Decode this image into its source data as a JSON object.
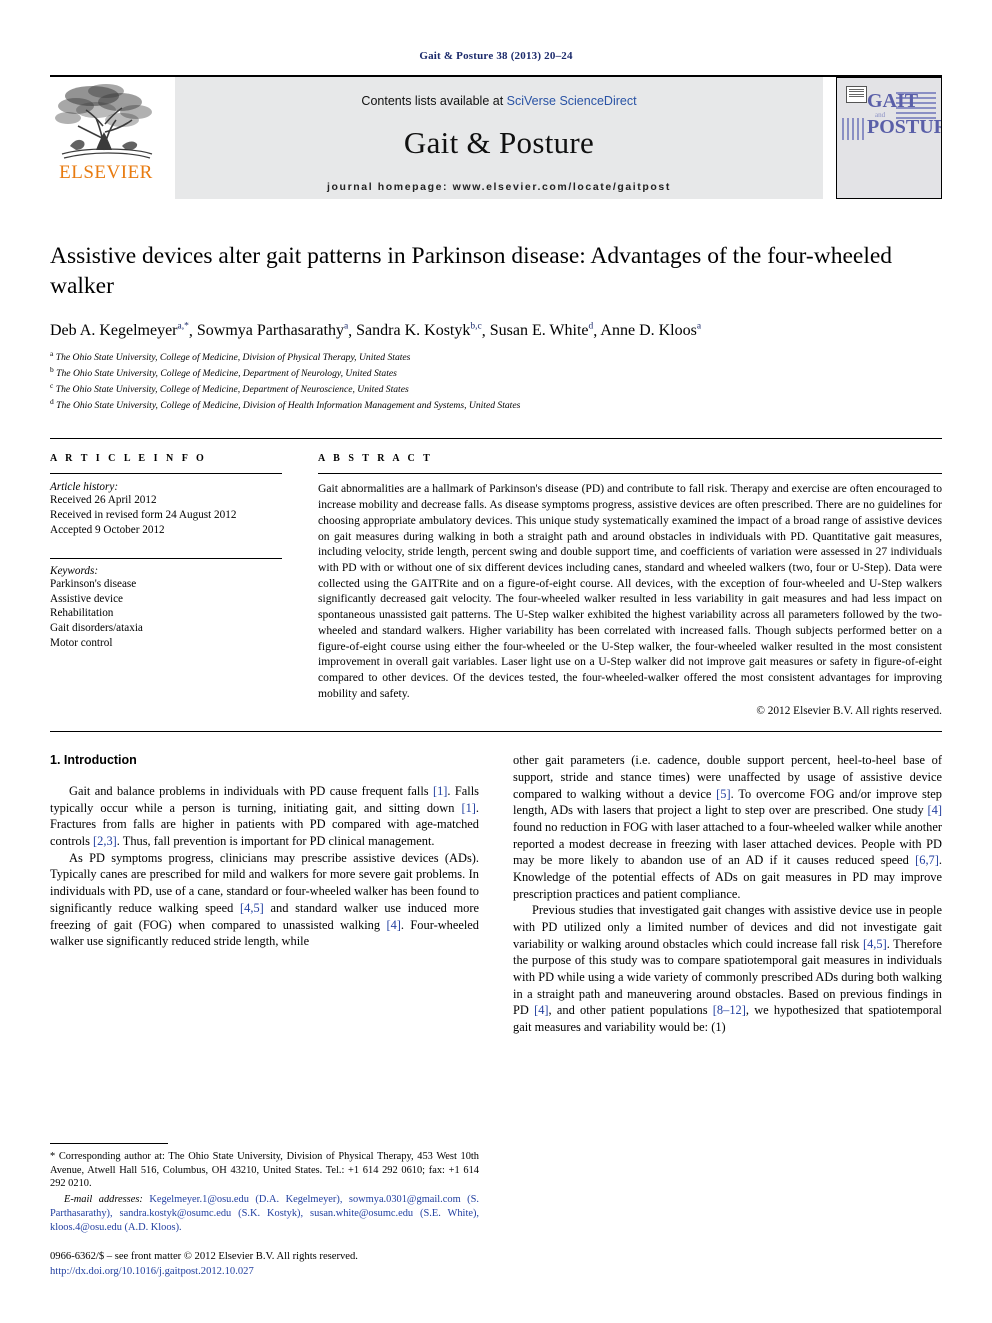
{
  "running_head": "Gait & Posture 38 (2013) 20–24",
  "masthead": {
    "publisher_wordmark": "ELSEVIER",
    "contents_prefix": "Contents lists available at ",
    "contents_link": "SciVerse ScienceDirect",
    "journal_name": "Gait & Posture",
    "homepage": "journal homepage: www.elsevier.com/locate/gaitpost",
    "cover": {
      "line1": "GAIT",
      "conjunction": "and",
      "line2": "POSTURE"
    }
  },
  "article": {
    "title": "Assistive devices alter gait patterns in Parkinson disease: Advantages of the four-wheeled walker",
    "authors": [
      {
        "name": "Deb A. Kegelmeyer",
        "marks": "a,*"
      },
      {
        "name": "Sowmya Parthasarathy",
        "marks": "a"
      },
      {
        "name": "Sandra K. Kostyk",
        "marks": "b,c"
      },
      {
        "name": "Susan E. White",
        "marks": "d"
      },
      {
        "name": "Anne D. Kloos",
        "marks": "a"
      }
    ],
    "affiliations": [
      {
        "mark": "a",
        "text": "The Ohio State University, College of Medicine, Division of Physical Therapy, United States"
      },
      {
        "mark": "b",
        "text": "The Ohio State University, College of Medicine, Department of Neurology, United States"
      },
      {
        "mark": "c",
        "text": "The Ohio State University, College of Medicine, Department of Neuroscience, United States"
      },
      {
        "mark": "d",
        "text": "The Ohio State University, College of Medicine, Division of Health Information Management and Systems, United States"
      }
    ]
  },
  "article_info": {
    "heading": "A R T I C L E  I N F O",
    "history_label": "Article history:",
    "history": [
      "Received 26 April 2012",
      "Received in revised form 24 August 2012",
      "Accepted 9 October 2012"
    ],
    "keywords_label": "Keywords:",
    "keywords": [
      "Parkinson's disease",
      "Assistive device",
      "Rehabilitation",
      "Gait disorders/ataxia",
      "Motor control"
    ]
  },
  "abstract": {
    "heading": "A B S T R A C T",
    "text": "Gait abnormalities are a hallmark of Parkinson's disease (PD) and contribute to fall risk. Therapy and exercise are often encouraged to increase mobility and decrease falls. As disease symptoms progress, assistive devices are often prescribed. There are no guidelines for choosing appropriate ambulatory devices. This unique study systematically examined the impact of a broad range of assistive devices on gait measures during walking in both a straight path and around obstacles in individuals with PD. Quantitative gait measures, including velocity, stride length, percent swing and double support time, and coefficients of variation were assessed in 27 individuals with PD with or without one of six different devices including canes, standard and wheeled walkers (two, four or U-Step). Data were collected using the GAITRite and on a figure-of-eight course. All devices, with the exception of four-wheeled and U-Step walkers significantly decreased gait velocity. The four-wheeled walker resulted in less variability in gait measures and had less impact on spontaneous unassisted gait patterns. The U-Step walker exhibited the highest variability across all parameters followed by the two-wheeled and standard walkers. Higher variability has been correlated with increased falls. Though subjects performed better on a figure-of-eight course using either the four-wheeled or the U-Step walker, the four-wheeled walker resulted in the most consistent improvement in overall gait variables. Laser light use on a U-Step walker did not improve gait measures or safety in figure-of-eight compared to other devices. Of the devices tested, the four-wheeled-walker offered the most consistent advantages for improving mobility and safety.",
    "copyright": "© 2012 Elsevier B.V. All rights reserved."
  },
  "body": {
    "section_heading": "1. Introduction",
    "left_paragraphs": [
      "Gait and balance problems in individuals with PD cause frequent falls [1]. Falls typically occur while a person is turning, initiating gait, and sitting down [1]. Fractures from falls are higher in patients with PD compared with age-matched controls [2,3]. Thus, fall prevention is important for PD clinical management.",
      "As PD symptoms progress, clinicians may prescribe assistive devices (ADs). Typically canes are prescribed for mild and walkers for more severe gait problems. In individuals with PD, use of a cane, standard or four-wheeled walker has been found to significantly reduce walking speed [4,5] and standard walker use induced more freezing of gait (FOG) when compared to unassisted walking [4]. Four-wheeled walker use significantly reduced stride length, while"
    ],
    "right_paragraphs": [
      "other gait parameters (i.e. cadence, double support percent, heel-to-heel base of support, stride and stance times) were unaffected by usage of assistive device compared to walking without a device [5]. To overcome FOG and/or improve step length, ADs with lasers that project a light to step over are prescribed. One study [4] found no reduction in FOG with laser attached to a four-wheeled walker while another reported a modest decrease in freezing with laser attached devices. People with PD may be more likely to abandon use of an AD if it causes reduced speed [6,7]. Knowledge of the potential effects of ADs on gait measures in PD may improve prescription practices and patient compliance.",
      "Previous studies that investigated gait changes with assistive device use in people with PD utilized only a limited number of devices and did not investigate gait variability or walking around obstacles which could increase fall risk [4,5]. Therefore the purpose of this study was to compare spatiotemporal gait measures in individuals with PD while using a wide variety of commonly prescribed ADs during both walking in a straight path and maneuvering around obstacles. Based on previous findings in PD [4], and other patient populations [8–12], we hypothesized that spatiotemporal gait measures and variability would be: (1)"
    ]
  },
  "footnotes": {
    "corresponding": "* Corresponding author at: The Ohio State University, Division of Physical Therapy, 453 West 10th Avenue, Atwell Hall 516, Columbus, OH 43210, United States. Tel.: +1 614 292 0610; fax: +1 614 292 0210.",
    "email_label": "E-mail addresses:",
    "emails": "Kegelmeyer.1@osu.edu (D.A. Kegelmeyer), sowmya.0301@gmail.com (S. Parthasarathy), sandra.kostyk@osumc.edu (S.K. Kostyk), susan.white@osumc.edu (S.E. White), kloos.4@osu.edu (A.D. Kloos).",
    "issn_line": "0966-6362/$ – see front matter © 2012 Elsevier B.V. All rights reserved.",
    "doi": "http://dx.doi.org/10.1016/j.gaitpost.2012.10.027"
  },
  "colors": {
    "link_blue": "#2340a0",
    "header_navy": "#1b2a6b",
    "elsevier_orange": "#E87B10",
    "cover_purple": "#5a5fa8",
    "banner_gray": "#e7e8e9"
  }
}
